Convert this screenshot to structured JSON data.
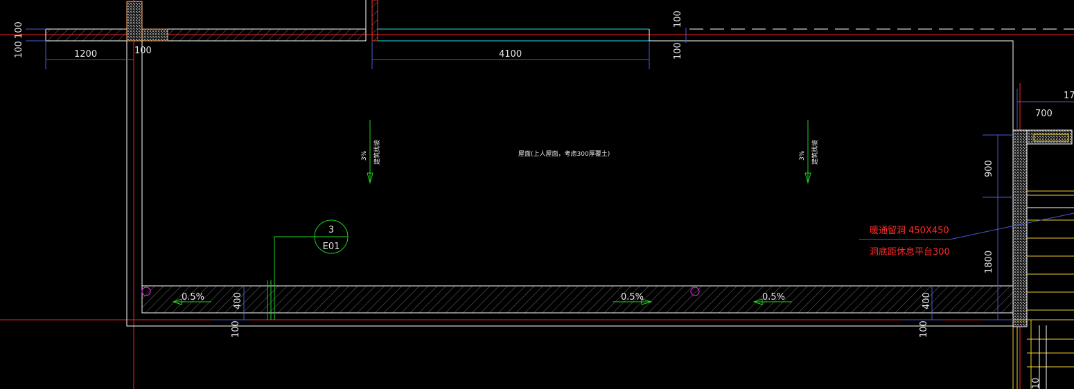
{
  "drawing": {
    "dimensions": {
      "left_top_100": "100",
      "left_bottom_100": "100",
      "left_1200": "1200",
      "corner_100": "100",
      "top_4100": "4100",
      "mid_top_100a": "100",
      "mid_top_100b": "100",
      "right_700": "700",
      "right_17": "17",
      "right_900": "900",
      "right_1800": "1800",
      "gutter_400_left": "400",
      "gutter_400_right": "400",
      "bottom_100_left": "100",
      "bottom_100_right": "100",
      "tiny_right": "10"
    },
    "slopes": {
      "left_pct": "3%",
      "left_text": "建筑找坡",
      "right_pct": "3%",
      "right_text": "建筑找坡",
      "gutter_1": "0.5%",
      "gutter_2": "0.5%",
      "gutter_3": "0.5%"
    },
    "roof_note": "屋面(上人屋面，考虑300厚覆土)",
    "section_marker": {
      "number": "3",
      "sheet": "E01"
    },
    "red_note": {
      "line1": "暖通留洞  450X450",
      "line2": "洞底距休息平台300"
    },
    "colors": {
      "background": "#000000",
      "wall": "#ffffff",
      "dimension": "#4a5bd6",
      "axis": "#ff2020",
      "green": "#22d322",
      "cyan": "#22e0e0",
      "magenta": "#e020e0",
      "yellow": "#f0d030",
      "hatch": "#6e6e6e"
    }
  }
}
